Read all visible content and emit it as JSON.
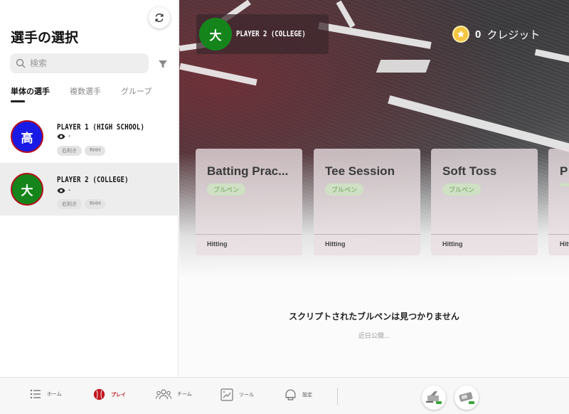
{
  "sidebar": {
    "title": "選手の選択",
    "search": {
      "placeholder": "検索",
      "value": ""
    },
    "tabs": [
      {
        "label": "単体の選手",
        "active": true
      },
      {
        "label": "複数選手",
        "active": false
      },
      {
        "label": "グループ",
        "active": false
      }
    ],
    "players": [
      {
        "initial": "高",
        "name": "PLAYER 1 (HIGH SCHOOL)",
        "views": "-",
        "chips": [
          "右利き",
          "RHH"
        ],
        "color": "#1a1ae6",
        "selected": false
      },
      {
        "initial": "大",
        "name": "PLAYER 2 (COLLEGE)",
        "views": "-",
        "chips": [
          "右利き",
          "RHH"
        ],
        "color": "#15851b",
        "selected": true
      }
    ]
  },
  "header": {
    "player_initial": "大",
    "player_name": "PLAYER 2 (COLLEGE)",
    "credits_value": "0",
    "credits_label": "クレジット"
  },
  "cards": [
    {
      "title": "Batting Prac...",
      "tag": "ブルペン",
      "category": "Hitting"
    },
    {
      "title": "Tee Session",
      "tag": "ブルペン",
      "category": "Hitting"
    },
    {
      "title": "Soft Toss",
      "tag": "ブルペン",
      "category": "Hitting"
    },
    {
      "title": "P",
      "tag": "",
      "category": "Hitt"
    }
  ],
  "empty_state": {
    "title": "スクリプトされたブルペンは見つかりません",
    "subtitle": "近日公開..."
  },
  "bottom_nav": [
    {
      "label": "ホーム",
      "icon": "menu-list-icon",
      "active": false
    },
    {
      "label": "プレイ",
      "icon": "baseball-icon",
      "active": true
    },
    {
      "label": "チーム",
      "icon": "team-icon",
      "active": false
    },
    {
      "label": "ツール",
      "icon": "tools-icon",
      "active": false
    },
    {
      "label": "設定",
      "icon": "helmet-icon",
      "active": false
    }
  ],
  "colors": {
    "accent": "#c0161f",
    "tag_green": "#6da35a",
    "player1": "#1a1ae6",
    "player2": "#15851b",
    "coin": "#f4c542"
  }
}
